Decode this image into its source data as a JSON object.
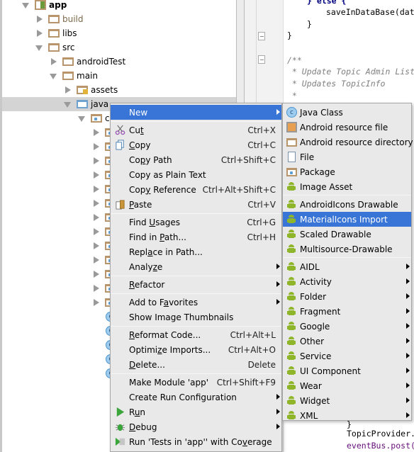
{
  "project_tree": {
    "items": [
      {
        "label": "app",
        "icon": "module-icon",
        "expanded": true
      },
      {
        "label": "build",
        "icon": "folder-icon",
        "expanded": false
      },
      {
        "label": "libs",
        "icon": "folder-icon",
        "expanded": false
      },
      {
        "label": "src",
        "icon": "folder-icon",
        "expanded": true
      },
      {
        "label": "androidTest",
        "icon": "folder-icon",
        "expanded": false
      },
      {
        "label": "main",
        "icon": "folder-icon",
        "expanded": true
      },
      {
        "label": "assets",
        "icon": "assets-folder-icon",
        "expanded": false
      },
      {
        "label": "java",
        "icon": "source-folder-icon",
        "expanded": true,
        "selected": true
      },
      {
        "label": "co",
        "icon": "package-icon",
        "expanded": true
      }
    ],
    "class_icon_letter": "c"
  },
  "editor": {
    "lines": [
      {
        "text": "} else {",
        "kind": "kw"
      },
      {
        "text": "saveInDataBase(dat",
        "kind": "plain"
      },
      {
        "text": "}",
        "kind": "plain"
      },
      {
        "text": "}",
        "kind": "plain"
      },
      {
        "text": "/**",
        "kind": "comment"
      },
      {
        "text": " * Update Topic Admin List",
        "kind": "comment"
      },
      {
        "text": " * Updates TopicInfo",
        "kind": "comment"
      },
      {
        "text": " *",
        "kind": "comment"
      },
      {
        "text": "}",
        "kind": "plain"
      },
      {
        "text": "TopicProvider.",
        "kind": "plain"
      },
      {
        "text": "eventBus.post(",
        "kind": "purple"
      }
    ]
  },
  "context_menu": {
    "new": "New",
    "cut": {
      "pre": "Cu",
      "u": "t",
      "post": "",
      "shortcut": "Ctrl+X"
    },
    "copy": {
      "pre": "",
      "u": "C",
      "post": "opy",
      "shortcut": "Ctrl+C"
    },
    "copy_path": {
      "pre": "Co",
      "u": "p",
      "post": "y Path",
      "shortcut": "Ctrl+Shift+C"
    },
    "copy_plain": {
      "label": "Copy as Plain Text"
    },
    "copy_ref": {
      "pre": "Cop",
      "u": "y",
      "post": " Reference",
      "shortcut": "Ctrl+Alt+Shift+C"
    },
    "paste": {
      "pre": "",
      "u": "P",
      "post": "aste",
      "shortcut": "Ctrl+V"
    },
    "find_usages": {
      "pre": "Find ",
      "u": "U",
      "post": "sages",
      "shortcut": "Ctrl+G"
    },
    "find_in_path": {
      "pre": "Find in ",
      "u": "P",
      "post": "ath...",
      "shortcut": "Ctrl+H"
    },
    "replace_in_path": {
      "pre": "Repl",
      "u": "a",
      "post": "ce in Path..."
    },
    "analyze": {
      "pre": "Analy",
      "u": "z",
      "post": "e"
    },
    "refactor": {
      "pre": "",
      "u": "R",
      "post": "efactor"
    },
    "favorites": {
      "pre": "Add to F",
      "u": "a",
      "post": "vorites"
    },
    "thumbnails": {
      "label": "Show Image Thumbnails"
    },
    "reformat": {
      "pre": "",
      "u": "R",
      "post": "eformat Code...",
      "shortcut": "Ctrl+Alt+L"
    },
    "optimize": {
      "pre": "Optimi",
      "u": "z",
      "post": "e Imports...",
      "shortcut": "Ctrl+Alt+O"
    },
    "delete": {
      "pre": "",
      "u": "D",
      "post": "elete...",
      "shortcut": "Delete"
    },
    "make_module": {
      "label": "Make Module 'app'",
      "shortcut": "Ctrl+Shift+F9"
    },
    "create_run": {
      "label": "Create Run Configuration"
    },
    "run": {
      "pre": "R",
      "u": "u",
      "post": "n"
    },
    "debug": {
      "pre": "",
      "u": "D",
      "post": "ebug"
    },
    "coverage": {
      "pre": "Run 'Tests in 'app'' with Co",
      "u": "v",
      "post": "erage"
    }
  },
  "new_submenu": {
    "items": [
      {
        "label": "Java Class",
        "icon": "java-class-icon"
      },
      {
        "label": "Android resource file",
        "icon": "android-resource-file-icon"
      },
      {
        "label": "Android resource directory",
        "icon": "folder-icon"
      },
      {
        "label": "File",
        "icon": "file-icon"
      },
      {
        "label": "Package",
        "icon": "package-icon"
      },
      {
        "label": "Image Asset",
        "icon": "android-icon"
      },
      {
        "label": "AndroidIcons Drawable",
        "icon": "android-icon"
      },
      {
        "label": "MaterialIcons Import",
        "icon": "android-icon",
        "highlighted": true
      },
      {
        "label": "Scaled Drawable",
        "icon": "android-icon"
      },
      {
        "label": "Multisource-Drawable",
        "icon": "android-icon"
      },
      {
        "label": "AIDL",
        "icon": "android-icon",
        "submenu": true
      },
      {
        "label": "Activity",
        "icon": "android-icon",
        "submenu": true
      },
      {
        "label": "Folder",
        "icon": "android-icon",
        "submenu": true
      },
      {
        "label": "Fragment",
        "icon": "android-icon",
        "submenu": true
      },
      {
        "label": "Google",
        "icon": "android-icon",
        "submenu": true
      },
      {
        "label": "Other",
        "icon": "android-icon",
        "submenu": true
      },
      {
        "label": "Service",
        "icon": "android-icon",
        "submenu": true
      },
      {
        "label": "UI Component",
        "icon": "android-icon",
        "submenu": true
      },
      {
        "label": "Wear",
        "icon": "android-icon",
        "submenu": true
      },
      {
        "label": "Widget",
        "icon": "android-icon",
        "submenu": true
      },
      {
        "label": "XML",
        "icon": "android-icon",
        "submenu": true
      }
    ]
  },
  "colors": {
    "highlight": "#3875d7",
    "menu_bg": "#e9e9e9",
    "android_green": "#8fb62a"
  }
}
